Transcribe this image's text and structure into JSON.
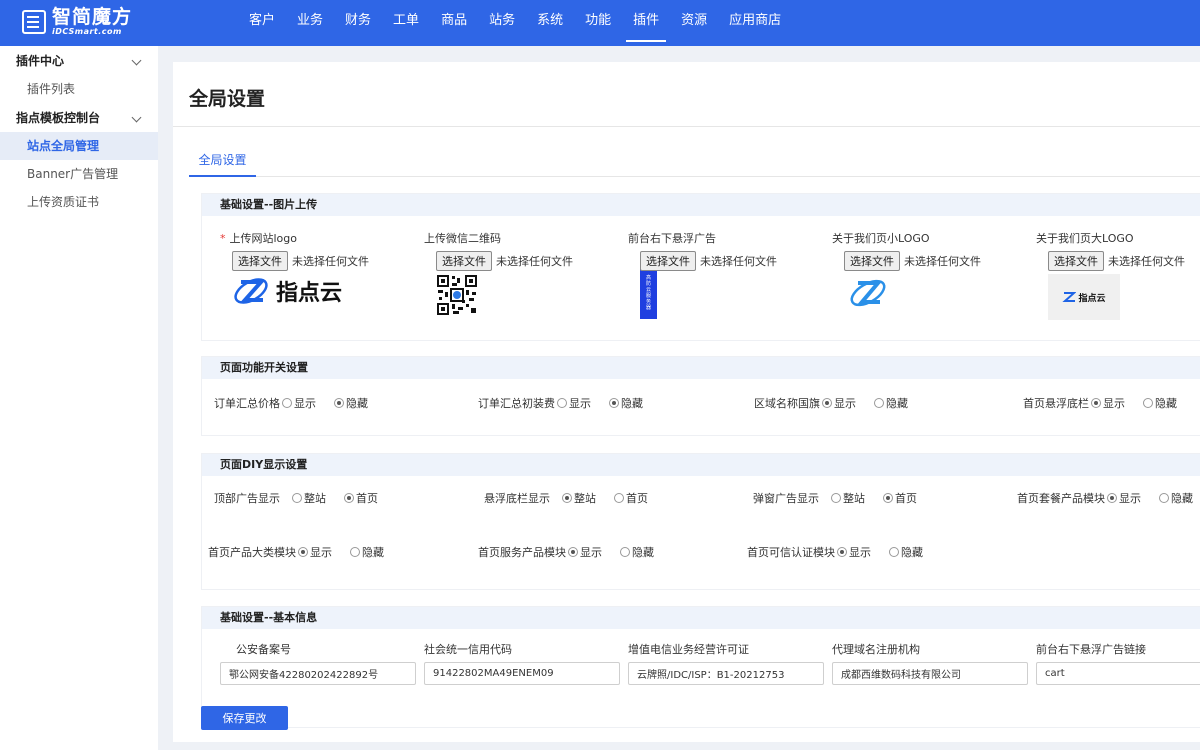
{
  "brand": {
    "name_cn": "智简魔方",
    "name_en": "iDCSmart.com"
  },
  "nav": {
    "items": [
      "客户",
      "业务",
      "财务",
      "工单",
      "商品",
      "站务",
      "系统",
      "功能",
      "插件",
      "资源",
      "应用商店"
    ],
    "active": "插件"
  },
  "sidebar": {
    "groups": [
      {
        "label": "插件中心",
        "items": [
          "插件列表"
        ]
      },
      {
        "label": "指点模板控制台",
        "items": [
          "站点全局管理",
          "Banner广告管理",
          "上传资质证书"
        ]
      }
    ],
    "active_item": "站点全局管理"
  },
  "page": {
    "title": "全局设置",
    "tab": "全局设置"
  },
  "upload_section": {
    "title": "基础设置--图片上传",
    "choose_label": "选择文件",
    "no_file_label": "未选择任何文件",
    "items": [
      {
        "label": "上传网站logo",
        "required": true,
        "logo_text": "指点云"
      },
      {
        "label": "上传微信二维码",
        "required": false
      },
      {
        "label": "前台右下悬浮广告",
        "required": false,
        "banner_text": "高防云服务器"
      },
      {
        "label": "关于我们页小LOGO",
        "required": false
      },
      {
        "label": "关于我们页大LOGO",
        "required": false,
        "logo_text": "指点云"
      }
    ]
  },
  "switch_section": {
    "title": "页面功能开关设置",
    "rows": [
      {
        "label": "订单汇总价格",
        "options": [
          "显示",
          "隐藏"
        ],
        "selected": "隐藏"
      },
      {
        "label": "订单汇总初装费",
        "options": [
          "显示",
          "隐藏"
        ],
        "selected": "隐藏"
      },
      {
        "label": "区域名称国旗",
        "options": [
          "显示",
          "隐藏"
        ],
        "selected": "显示"
      },
      {
        "label": "首页悬浮底栏",
        "options": [
          "显示",
          "隐藏"
        ],
        "selected": "显示"
      }
    ]
  },
  "diy_section": {
    "title": "页面DIY显示设置",
    "rows": [
      {
        "label": "顶部广告显示",
        "options": [
          "整站",
          "首页"
        ],
        "selected": "首页"
      },
      {
        "label": "悬浮底栏显示",
        "options": [
          "整站",
          "首页"
        ],
        "selected": "整站"
      },
      {
        "label": "弹窗广告显示",
        "options": [
          "整站",
          "首页"
        ],
        "selected": "首页"
      },
      {
        "label": "首页套餐产品模块",
        "options": [
          "显示",
          "隐藏"
        ],
        "selected": "显示"
      },
      {
        "label": "首页产品大类模块",
        "options": [
          "显示",
          "隐藏"
        ],
        "selected": "显示"
      },
      {
        "label": "首页服务产品模块",
        "options": [
          "显示",
          "隐藏"
        ],
        "selected": "显示"
      },
      {
        "label": "首页可信认证模块",
        "options": [
          "显示",
          "隐藏"
        ],
        "selected": "显示"
      }
    ]
  },
  "info_section": {
    "title": "基础设置--基本信息",
    "fields": [
      {
        "label": "公安备案号",
        "value": "鄂公网安备42280202422892号"
      },
      {
        "label": "社会统一信用代码",
        "value": "91422802MA49ENEM09"
      },
      {
        "label": "增值电信业务经营许可证",
        "value": "云牌照/IDC/ISP：B1-20212753"
      },
      {
        "label": "代理域名注册机构",
        "value": "成都西维数码科技有限公司"
      },
      {
        "label": "前台右下悬浮广告链接",
        "value": "cart"
      }
    ]
  },
  "save_label": "保存更改",
  "colors": {
    "primary": "#2f66e6",
    "section_header": "#eef3fb",
    "logo_blue": "#1e64e6"
  }
}
